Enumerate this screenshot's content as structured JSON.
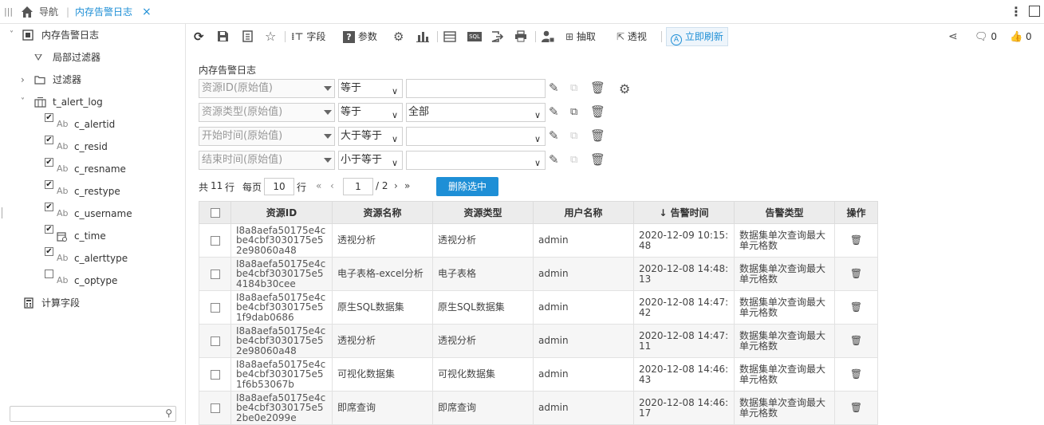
{
  "topbar": {
    "nav_label": "导航",
    "tab_label": "内存告警日志",
    "close_glyph": "×"
  },
  "sidebar": {
    "root_label": "内存告警日志",
    "local_filter": "局部过滤器",
    "filter": "过滤器",
    "table_name": "t_alert_log",
    "fields": [
      {
        "type": "Ab",
        "name": "c_alertid",
        "checked": true
      },
      {
        "type": "Ab",
        "name": "c_resid",
        "checked": true
      },
      {
        "type": "Ab",
        "name": "c_resname",
        "checked": true
      },
      {
        "type": "Ab",
        "name": "c_restype",
        "checked": true
      },
      {
        "type": "Ab",
        "name": "c_username",
        "checked": true
      },
      {
        "type": "date",
        "name": "c_time",
        "checked": true
      },
      {
        "type": "Ab",
        "name": "c_alerttype",
        "checked": true
      },
      {
        "type": "Ab",
        "name": "c_optype",
        "checked": false
      }
    ],
    "calc_fields": "计算字段",
    "search_placeholder": ""
  },
  "toolbar": {
    "field_label": "字段",
    "param_label": "参数",
    "extract_label": "抽取",
    "pivot_label": "透视",
    "refresh_label": "立即刷新",
    "comment_count": "0",
    "like_count": "0"
  },
  "filter": {
    "title": "内存告警日志",
    "rows": [
      {
        "field": "资源ID(原始值)",
        "op": "等于",
        "value": ""
      },
      {
        "field": "资源类型(原始值)",
        "op": "等于",
        "value": "全部"
      },
      {
        "field": "开始时间(原始值)",
        "op": "大于等于",
        "value": ""
      },
      {
        "field": "结束时间(原始值)",
        "op": "小于等于",
        "value": ""
      }
    ]
  },
  "pager": {
    "total_prefix": "共",
    "total_count": "11",
    "total_suffix": "行",
    "per_page_label": "每页",
    "per_page": "10",
    "per_page_suffix": "行",
    "current_page": "1",
    "total_pages": "/ 2",
    "delete_selected": "删除选中"
  },
  "table": {
    "columns": [
      "资源ID",
      "资源名称",
      "资源类型",
      "用户名称",
      "告警时间",
      "告警类型",
      "操作"
    ],
    "sort_arrow": "↓",
    "rows": [
      {
        "id": "I8a8aefa50175e4cbe4cbf3030175e52e98060a48",
        "name": "透视分析",
        "type": "透视分析",
        "user": "admin",
        "time": "2020-12-09 10:15:48",
        "alert": "数据集单次查询最大单元格数"
      },
      {
        "id": "I8a8aefa50175e4cbe4cbf3030175e54184b30cee",
        "name": "电子表格-excel分析",
        "type": "电子表格",
        "user": "admin",
        "time": "2020-12-08 14:48:13",
        "alert": "数据集单次查询最大单元格数"
      },
      {
        "id": "I8a8aefa50175e4cbe4cbf3030175e51f9dab0686",
        "name": "原生SQL数据集",
        "type": "原生SQL数据集",
        "user": "admin",
        "time": "2020-12-08 14:47:42",
        "alert": "数据集单次查询最大单元格数"
      },
      {
        "id": "I8a8aefa50175e4cbe4cbf3030175e52e98060a48",
        "name": "透视分析",
        "type": "透视分析",
        "user": "admin",
        "time": "2020-12-08 14:47:11",
        "alert": "数据集单次查询最大单元格数"
      },
      {
        "id": "I8a8aefa50175e4cbe4cbf3030175e51f6b53067b",
        "name": "可视化数据集",
        "type": "可视化数据集",
        "user": "admin",
        "time": "2020-12-08 14:46:43",
        "alert": "数据集单次查询最大单元格数"
      },
      {
        "id": "I8a8aefa50175e4cbe4cbf3030175e52be0e2099e",
        "name": "即席查询",
        "type": "即席查询",
        "user": "admin",
        "time": "2020-12-08 14:46:17",
        "alert": "数据集单次查询最大单元格数"
      }
    ]
  },
  "colors": {
    "accent": "#1e8fd6",
    "header_bg": "#ececec"
  }
}
